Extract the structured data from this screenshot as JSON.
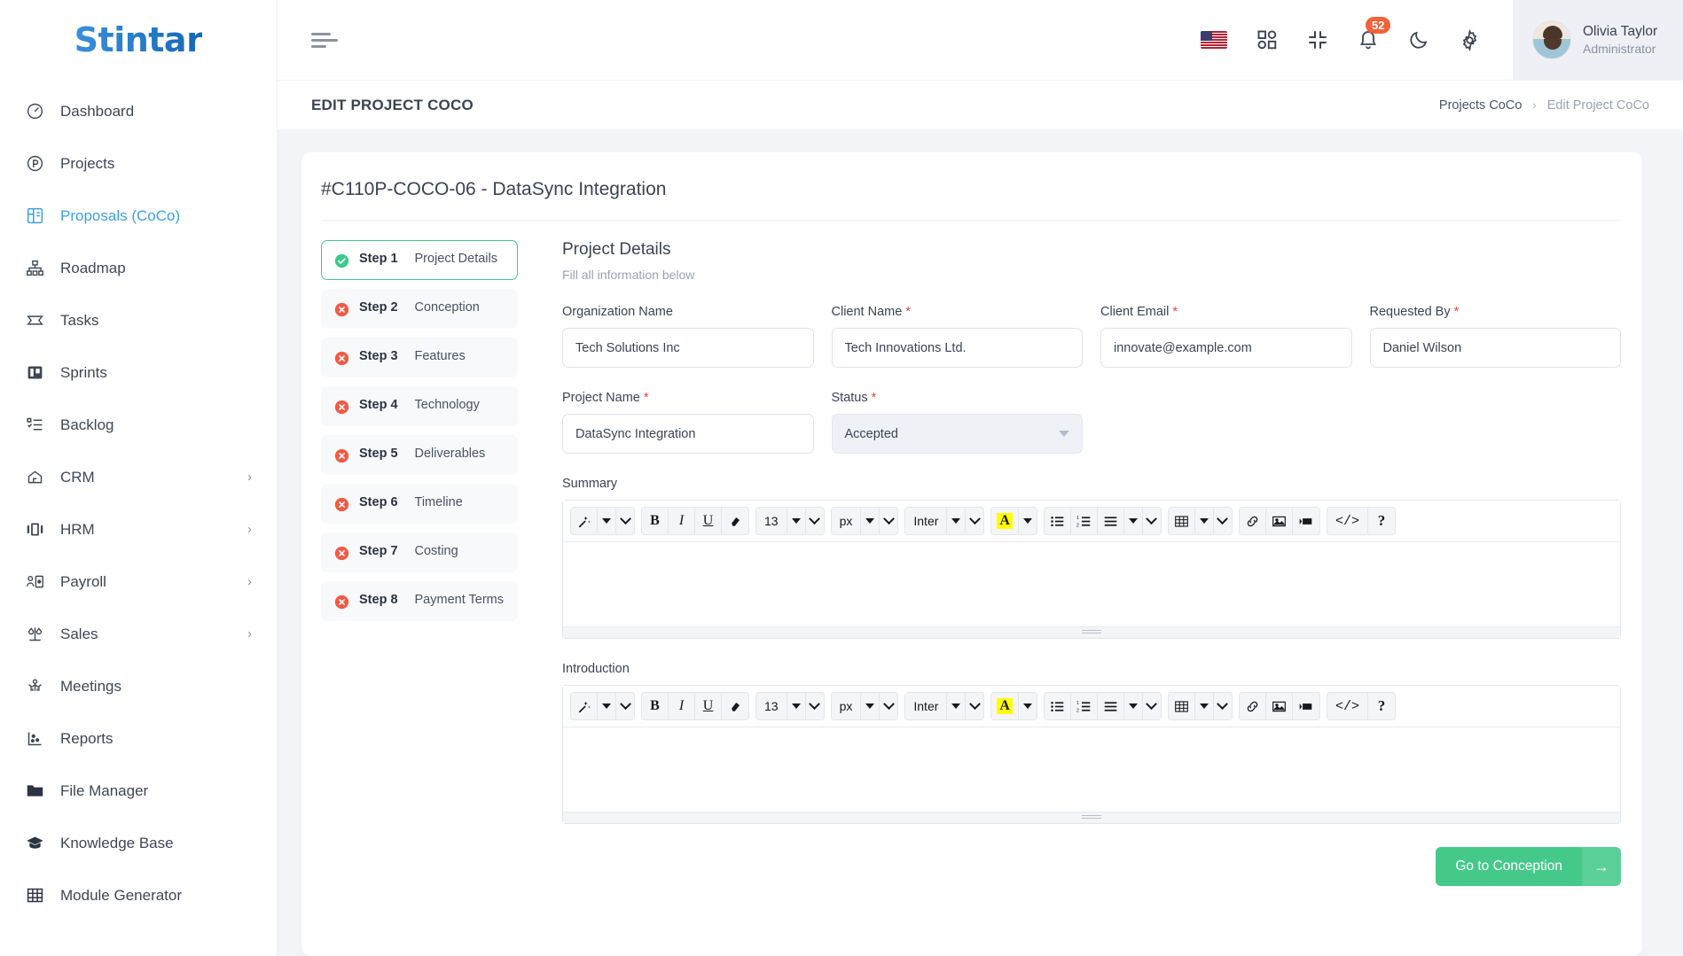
{
  "brand": {
    "name": "Stintar"
  },
  "sidebar": {
    "items": [
      {
        "label": "Dashboard",
        "icon": "dashboard-icon",
        "has_submenu": false,
        "active": false
      },
      {
        "label": "Projects",
        "icon": "projects-icon",
        "has_submenu": false,
        "active": false
      },
      {
        "label": "Proposals (CoCo)",
        "icon": "proposals-icon",
        "has_submenu": false,
        "active": true
      },
      {
        "label": "Roadmap",
        "icon": "roadmap-icon",
        "has_submenu": false,
        "active": false
      },
      {
        "label": "Tasks",
        "icon": "tasks-icon",
        "has_submenu": false,
        "active": false
      },
      {
        "label": "Sprints",
        "icon": "sprints-icon",
        "has_submenu": false,
        "active": false
      },
      {
        "label": "Backlog",
        "icon": "backlog-icon",
        "has_submenu": false,
        "active": false
      },
      {
        "label": "CRM",
        "icon": "crm-icon",
        "has_submenu": true,
        "active": false
      },
      {
        "label": "HRM",
        "icon": "hrm-icon",
        "has_submenu": true,
        "active": false
      },
      {
        "label": "Payroll",
        "icon": "payroll-icon",
        "has_submenu": true,
        "active": false
      },
      {
        "label": "Sales",
        "icon": "sales-icon",
        "has_submenu": true,
        "active": false
      },
      {
        "label": "Meetings",
        "icon": "meetings-icon",
        "has_submenu": false,
        "active": false
      },
      {
        "label": "Reports",
        "icon": "reports-icon",
        "has_submenu": false,
        "active": false
      },
      {
        "label": "File Manager",
        "icon": "folder-icon",
        "has_submenu": false,
        "active": false
      },
      {
        "label": "Knowledge Base",
        "icon": "graduation-cap-icon",
        "has_submenu": false,
        "active": false
      },
      {
        "label": "Module Generator",
        "icon": "grid-icon",
        "has_submenu": false,
        "active": false
      }
    ]
  },
  "topbar": {
    "menu_toggle": "hamburger-icon",
    "language_flag": "us-flag-icon",
    "apps": "apps-grid-icon",
    "fullscreen": "collapse-fullscreen-icon",
    "notifications": {
      "icon": "bell-icon",
      "count": "52"
    },
    "theme": "moon-icon",
    "settings": "gear-icon",
    "profile": {
      "name": "Olivia Taylor",
      "role": "Administrator"
    }
  },
  "pagehead": {
    "title": "EDIT PROJECT COCO",
    "breadcrumb": {
      "parent": "Projects CoCo",
      "separator": "›",
      "current": "Edit Project CoCo"
    }
  },
  "card": {
    "title": "#C110P-COCO-06 - DataSync Integration"
  },
  "steps": [
    {
      "num": "Step 1",
      "name": "Project Details",
      "state": "done",
      "active": true
    },
    {
      "num": "Step 2",
      "name": "Conception",
      "state": "error",
      "active": false
    },
    {
      "num": "Step 3",
      "name": "Features",
      "state": "error",
      "active": false
    },
    {
      "num": "Step 4",
      "name": "Technology",
      "state": "error",
      "active": false
    },
    {
      "num": "Step 5",
      "name": "Deliverables",
      "state": "error",
      "active": false
    },
    {
      "num": "Step 6",
      "name": "Timeline",
      "state": "error",
      "active": false
    },
    {
      "num": "Step 7",
      "name": "Costing",
      "state": "error",
      "active": false
    },
    {
      "num": "Step 8",
      "name": "Payment Terms",
      "state": "error",
      "active": false
    }
  ],
  "form": {
    "heading": "Project Details",
    "subheading": "Fill all information below",
    "fields": {
      "organization_name": {
        "label": "Organization Name",
        "required": false,
        "value": "Tech Solutions Inc"
      },
      "client_name": {
        "label": "Client Name",
        "required": true,
        "value": "Tech Innovations Ltd."
      },
      "client_email": {
        "label": "Client Email",
        "required": true,
        "value": "innovate@example.com"
      },
      "requested_by": {
        "label": "Requested By",
        "required": true,
        "value": "Daniel Wilson"
      },
      "project_name": {
        "label": "Project Name",
        "required": true,
        "value": "DataSync Integration"
      },
      "status": {
        "label": "Status",
        "required": true,
        "value": "Accepted"
      }
    },
    "summary": {
      "label": "Summary",
      "value": ""
    },
    "introduction": {
      "label": "Introduction",
      "value": ""
    }
  },
  "editor_toolbar": {
    "magic": "magic-wand-icon",
    "bold": "B",
    "italic": "I",
    "underline": "U",
    "eraser": "clear-format-icon",
    "font_size": "13",
    "size_unit": "px",
    "font_family": "Inter",
    "highlight": "A",
    "unordered_list": "bullet-list-icon",
    "ordered_list": "numbered-list-icon",
    "align": "align-icon",
    "table": "table-icon",
    "link": "link-icon",
    "image": "image-icon",
    "video": "video-icon",
    "code": "</>",
    "help": "?"
  },
  "footer": {
    "next_label": "Go to Conception",
    "next_arrow": "arrow-right-icon"
  },
  "colors": {
    "accent_blue": "#3aa0e8",
    "success_green": "#3dc98a",
    "error_red": "#f05a45",
    "button_green": "#45c98a",
    "badge_orange": "#f4623a",
    "required_red": "#e8453c"
  }
}
